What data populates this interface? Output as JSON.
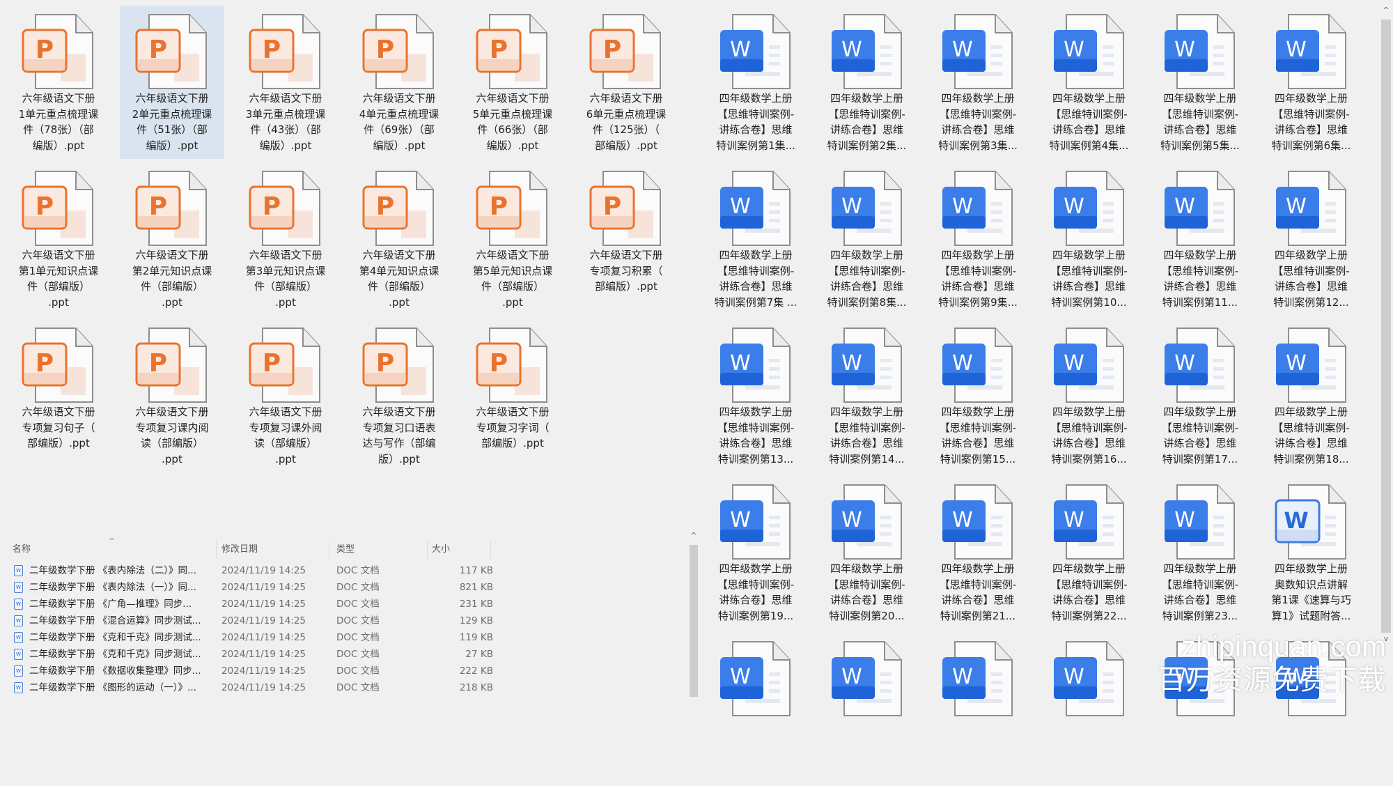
{
  "ppt_files": [
    {
      "lines": [
        "六年级语文下册",
        "1单元重点梳理课",
        "件（78张）（部",
        "编版）.ppt"
      ]
    },
    {
      "lines": [
        "六年级语文下册",
        "2单元重点梳理课",
        "件（51张）（部",
        "编版）.ppt"
      ],
      "selected": true
    },
    {
      "lines": [
        "六年级语文下册",
        "3单元重点梳理课",
        "件（43张）（部",
        "编版）.ppt"
      ]
    },
    {
      "lines": [
        "六年级语文下册",
        "4单元重点梳理课",
        "件（69张）（部",
        "编版）.ppt"
      ]
    },
    {
      "lines": [
        "六年级语文下册",
        "5单元重点梳理课",
        "件（66张）（部",
        "编版）.ppt"
      ]
    },
    {
      "lines": [
        "六年级语文下册",
        "6单元重点梳理课",
        "件（125张）（",
        "部编版）.ppt"
      ]
    },
    {
      "lines": [
        "六年级语文下册",
        "第1单元知识点课",
        "件（部编版）",
        ".ppt"
      ]
    },
    {
      "lines": [
        "六年级语文下册",
        "第2单元知识点课",
        "件（部编版）",
        ".ppt"
      ]
    },
    {
      "lines": [
        "六年级语文下册",
        "第3单元知识点课",
        "件（部编版）",
        ".ppt"
      ]
    },
    {
      "lines": [
        "六年级语文下册",
        "第4单元知识点课",
        "件（部编版）",
        ".ppt"
      ]
    },
    {
      "lines": [
        "六年级语文下册",
        "第5单元知识点课",
        "件（部编版）",
        ".ppt"
      ]
    },
    {
      "lines": [
        "六年级语文下册",
        "专项复习积累（",
        "部编版）.ppt"
      ]
    },
    {
      "lines": [
        "六年级语文下册",
        "专项复习句子（",
        "部编版）.ppt"
      ]
    },
    {
      "lines": [
        "六年级语文下册",
        "专项复习课内阅",
        "读（部编版）",
        ".ppt"
      ]
    },
    {
      "lines": [
        "六年级语文下册",
        "专项复习课外阅",
        "读（部编版）",
        ".ppt"
      ]
    },
    {
      "lines": [
        "六年级语文下册",
        "专项复习口语表",
        "达与写作（部编",
        "版）.ppt"
      ]
    },
    {
      "lines": [
        "六年级语文下册",
        "专项复习字词（",
        "部编版）.ppt"
      ]
    }
  ],
  "doc_files": [
    {
      "lines": [
        "四年级数学上册",
        "【思维特训案例-",
        "讲练合卷】思维",
        "特训案例第1集..."
      ]
    },
    {
      "lines": [
        "四年级数学上册",
        "【思维特训案例-",
        "讲练合卷】思维",
        "特训案例第2集..."
      ]
    },
    {
      "lines": [
        "四年级数学上册",
        "【思维特训案例-",
        "讲练合卷】思维",
        "特训案例第3集..."
      ]
    },
    {
      "lines": [
        "四年级数学上册",
        "【思维特训案例-",
        "讲练合卷】思维",
        "特训案例第4集..."
      ]
    },
    {
      "lines": [
        "四年级数学上册",
        "【思维特训案例-",
        "讲练合卷】思维",
        "特训案例第5集..."
      ]
    },
    {
      "lines": [
        "四年级数学上册",
        "【思维特训案例-",
        "讲练合卷】思维",
        "特训案例第6集..."
      ]
    },
    {
      "lines": [
        "四年级数学上册",
        "【思维特训案例-",
        "讲练合卷】思维",
        "特训案例第7集 ..."
      ]
    },
    {
      "lines": [
        "四年级数学上册",
        "【思维特训案例-",
        "讲练合卷】思维",
        "特训案例第8集..."
      ]
    },
    {
      "lines": [
        "四年级数学上册",
        "【思维特训案例-",
        "讲练合卷】思维",
        "特训案例第9集..."
      ]
    },
    {
      "lines": [
        "四年级数学上册",
        "【思维特训案例-",
        "讲练合卷】思维",
        "特训案例第10..."
      ]
    },
    {
      "lines": [
        "四年级数学上册",
        "【思维特训案例-",
        "讲练合卷】思维",
        "特训案例第11..."
      ]
    },
    {
      "lines": [
        "四年级数学上册",
        "【思维特训案例-",
        "讲练合卷】思维",
        "特训案例第12..."
      ]
    },
    {
      "lines": [
        "四年级数学上册",
        "【思维特训案例-",
        "讲练合卷】思维",
        "特训案例第13..."
      ]
    },
    {
      "lines": [
        "四年级数学上册",
        "【思维特训案例-",
        "讲练合卷】思维",
        "特训案例第14..."
      ]
    },
    {
      "lines": [
        "四年级数学上册",
        "【思维特训案例-",
        "讲练合卷】思维",
        "特训案例第15..."
      ]
    },
    {
      "lines": [
        "四年级数学上册",
        "【思维特训案例-",
        "讲练合卷】思维",
        "特训案例第16..."
      ]
    },
    {
      "lines": [
        "四年级数学上册",
        "【思维特训案例-",
        "讲练合卷】思维",
        "特训案例第17..."
      ]
    },
    {
      "lines": [
        "四年级数学上册",
        "【思维特训案例-",
        "讲练合卷】思维",
        "特训案例第18..."
      ]
    },
    {
      "lines": [
        "四年级数学上册",
        "【思维特训案例-",
        "讲练合卷】思维",
        "特训案例第19..."
      ]
    },
    {
      "lines": [
        "四年级数学上册",
        "【思维特训案例-",
        "讲练合卷】思维",
        "特训案例第20..."
      ]
    },
    {
      "lines": [
        "四年级数学上册",
        "【思维特训案例-",
        "讲练合卷】思维",
        "特训案例第21..."
      ]
    },
    {
      "lines": [
        "四年级数学上册",
        "【思维特训案例-",
        "讲练合卷】思维",
        "特训案例第22..."
      ]
    },
    {
      "lines": [
        "四年级数学上册",
        "【思维特训案例-",
        "讲练合卷】思维",
        "特训案例第23..."
      ]
    },
    {
      "lines": [
        "四年级数学上册",
        "奥数知识点讲解",
        "第1课《速算与巧",
        "算1》试题附答..."
      ],
      "variant": "light"
    }
  ],
  "doc_files_partial_row_count": 6,
  "details_list": {
    "columns": {
      "name": "名称",
      "date": "修改日期",
      "type": "类型",
      "size": "大小"
    },
    "rows": [
      {
        "name": "二年级数学下册 《表内除法（二）》同...",
        "date": "2024/11/19 14:25",
        "type": "DOC 文档",
        "size": "117 KB"
      },
      {
        "name": "二年级数学下册 《表内除法（一）》同...",
        "date": "2024/11/19 14:25",
        "type": "DOC 文档",
        "size": "821 KB"
      },
      {
        "name": "二年级数学下册 《广角—推理》同步...",
        "date": "2024/11/19 14:25",
        "type": "DOC 文档",
        "size": "231 KB"
      },
      {
        "name": "二年级数学下册 《混合运算》同步测试...",
        "date": "2024/11/19 14:25",
        "type": "DOC 文档",
        "size": "129 KB"
      },
      {
        "name": "二年级数学下册 《克和千克》同步测试...",
        "date": "2024/11/19 14:25",
        "type": "DOC 文档",
        "size": "119 KB"
      },
      {
        "name": "二年级数学下册 《克和千克》同步测试...",
        "date": "2024/11/19 14:25",
        "type": "DOC 文档",
        "size": "27 KB"
      },
      {
        "name": "二年级数学下册 《数据收集整理》同步...",
        "date": "2024/11/19 14:25",
        "type": "DOC 文档",
        "size": "222 KB"
      },
      {
        "name": "二年级数学下册 《图形的运动（一）》...",
        "date": "2024/11/19 14:25",
        "type": "DOC 文档",
        "size": "218 KB"
      }
    ]
  },
  "watermark": {
    "domain": "zhipinquan.com",
    "slogan": "百万资源免费下载"
  },
  "colors": {
    "ppt": "#e8732f",
    "word": "#1f63d8",
    "selection": "#d9e4f0"
  }
}
